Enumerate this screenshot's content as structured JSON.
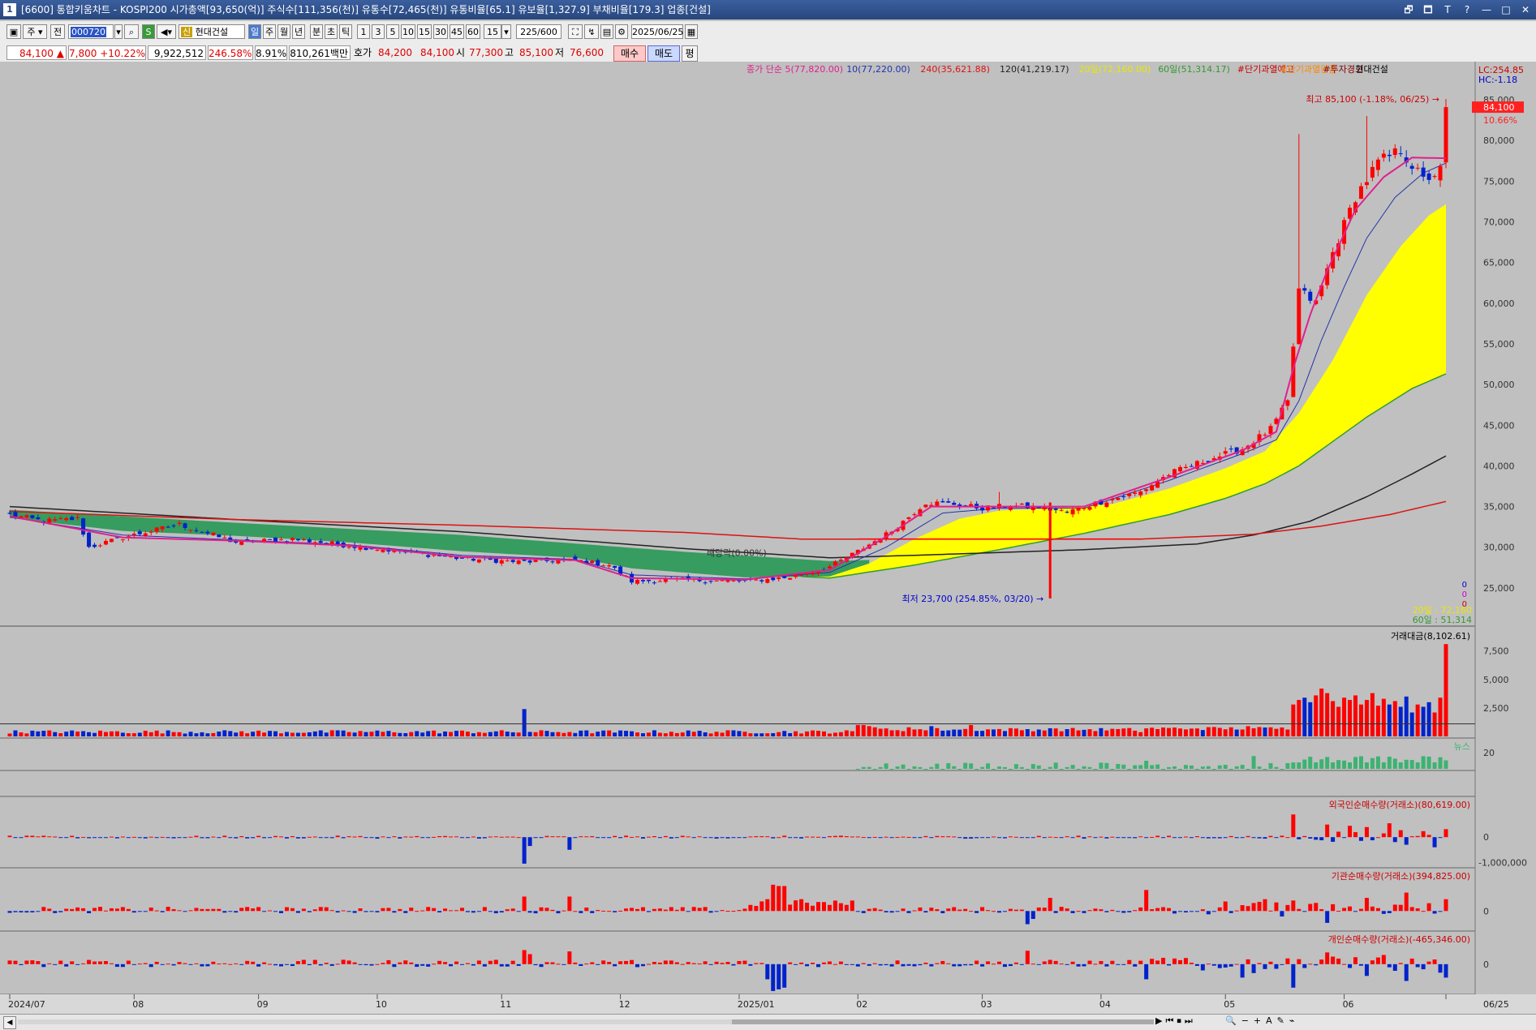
{
  "window": {
    "title": "[6600] 통합키움차트 - KOSPI200 시가총액[93,650(억)] 주식수[111,356(천)] 유통수[72,465(천)] 유통비율[65.1] 유보율[1,327.9] 부채비율[179.3] 업종[건설]",
    "controls": [
      "🗗",
      "🗖",
      "T",
      "?",
      "—",
      "□",
      "✕"
    ]
  },
  "toolbar": {
    "period": "주",
    "prev_label": "전",
    "code": "000720",
    "stock_name": "현대건설",
    "credit_badge": "신",
    "tf_active": "일",
    "tf_items": [
      "주",
      "월",
      "년",
      "분",
      "초",
      "틱"
    ],
    "intervals": [
      "1",
      "3",
      "5",
      "10",
      "15",
      "30",
      "45",
      "60",
      "15"
    ],
    "count": "225",
    "count_max": "/600",
    "date": "2025/06/25"
  },
  "quote": {
    "price": "84,100",
    "up_arrow": "▲",
    "change": "7,800",
    "change_pct": "+10.22%",
    "volume": "9,922,512",
    "volume_ratio": "246.58%",
    "turnover": "8.91%",
    "amount": "810,261백만",
    "hoga_label": "호가",
    "hoga1": "84,200",
    "hoga2": "84,100",
    "open_label": "시",
    "open": "77,300",
    "high_label": "고",
    "high": "85,100",
    "low_label": "저",
    "low": "76,600",
    "buy": "매수",
    "sell": "매도",
    "avg": "평"
  },
  "colors": {
    "up": "#ff0000",
    "down": "#0022cc",
    "ma5": "#e0208f",
    "ma10": "#2233aa",
    "ma240": "#dd1111",
    "ma120": "#222222",
    "ma20_fill": "#ffff00",
    "ma60": "#339933",
    "cloud": "#2e9a5a",
    "news": "#3cb371",
    "background": "#c0c0c0"
  },
  "chart_data": [
    {
      "type": "candlestick",
      "legend": [
        {
          "text": "종가 단순 5(77,820.00)",
          "color": "#e0208f"
        },
        {
          "text": "10(77,220.00)",
          "color": "#2233aa"
        },
        {
          "text": "240(35,621.88)",
          "color": "#dd1111"
        },
        {
          "text": "120(41,219.17)",
          "color": "#222222"
        },
        {
          "text": "20일(72,160.00)",
          "color": "#e8e800"
        },
        {
          "text": "60일(51,314.17)",
          "color": "#339933"
        },
        {
          "text": "#단기과열예고",
          "color": "#cc0000"
        },
        {
          "text": "#단기과열완출",
          "color": "#ff8800"
        },
        {
          "text": "#투자경고",
          "color": "#880000"
        },
        {
          "text": "현대건설",
          "color": "#000000"
        }
      ],
      "lc_label": "LC:254.85",
      "hc_label": "HC:-1.18",
      "price_label": "84,100",
      "pct_label": "10.66%",
      "high_annotation": "최고 85,100 (-1.18%, 06/25)",
      "low_annotation": "최저 23,700 (254.85%, 03/20)",
      "dividend_annotation": "배당락(0.00%)",
      "right_zero_labels": [
        "0",
        "0",
        "0"
      ],
      "ma20_label": "20일 : 72,160",
      "ma60_label": "60일 : 51,314",
      "y_ticks": [
        85000,
        80000,
        75000,
        70000,
        65000,
        60000,
        55000,
        50000,
        45000,
        40000,
        35000,
        30000,
        25000
      ],
      "y_tick_labels": [
        "85,000",
        "80,000",
        "75,000",
        "70,000",
        "65,000",
        "60,000",
        "55,000",
        "50,000",
        "45,000",
        "40,000",
        "35,000",
        "30,000",
        "25,000"
      ],
      "ylim": [
        20500,
        87500
      ],
      "x_labels": [
        {
          "text": "2024/07",
          "idx": 0
        },
        {
          "text": "08",
          "idx": 22
        },
        {
          "text": "09",
          "idx": 44
        },
        {
          "text": "10",
          "idx": 65
        },
        {
          "text": "11",
          "idx": 87
        },
        {
          "text": "12",
          "idx": 108
        },
        {
          "text": "2025/01",
          "idx": 129
        },
        {
          "text": "02",
          "idx": 150
        },
        {
          "text": "03",
          "idx": 172
        },
        {
          "text": "04",
          "idx": 193
        },
        {
          "text": "05",
          "idx": 215
        },
        {
          "text": "06",
          "idx": 236
        },
        {
          "text": "06/25",
          "idx": 254
        }
      ],
      "n_bars": 255,
      "close_anchors": [
        [
          0,
          34000
        ],
        [
          6,
          33200
        ],
        [
          12,
          33500
        ],
        [
          14,
          30000
        ],
        [
          20,
          31200
        ],
        [
          30,
          32800
        ],
        [
          40,
          30600
        ],
        [
          50,
          31000
        ],
        [
          60,
          30200
        ],
        [
          70,
          29400
        ],
        [
          80,
          28600
        ],
        [
          90,
          28200
        ],
        [
          100,
          28400
        ],
        [
          106,
          27800
        ],
        [
          110,
          25800
        ],
        [
          118,
          26000
        ],
        [
          130,
          25800
        ],
        [
          138,
          26300
        ],
        [
          145,
          27600
        ],
        [
          150,
          29500
        ],
        [
          156,
          32000
        ],
        [
          162,
          35500
        ],
        [
          167,
          35300
        ],
        [
          172,
          34800
        ],
        [
          177,
          35100
        ],
        [
          182,
          34900
        ],
        [
          187,
          34300
        ],
        [
          192,
          35400
        ],
        [
          200,
          36800
        ],
        [
          205,
          39000
        ],
        [
          212,
          40800
        ],
        [
          218,
          42100
        ],
        [
          223,
          44500
        ],
        [
          226,
          47800
        ],
        [
          228,
          61600
        ],
        [
          231,
          60000
        ],
        [
          234,
          66200
        ],
        [
          238,
          73100
        ],
        [
          242,
          77300
        ],
        [
          246,
          78800
        ],
        [
          250,
          75100
        ],
        [
          253,
          76300
        ],
        [
          254,
          84100
        ]
      ],
      "ma5_anchors": [
        [
          0,
          33800
        ],
        [
          20,
          31200
        ],
        [
          40,
          30800
        ],
        [
          60,
          30200
        ],
        [
          80,
          28800
        ],
        [
          100,
          28400
        ],
        [
          110,
          26200
        ],
        [
          130,
          26000
        ],
        [
          145,
          27200
        ],
        [
          155,
          31300
        ],
        [
          163,
          35000
        ],
        [
          175,
          35000
        ],
        [
          190,
          35000
        ],
        [
          205,
          38600
        ],
        [
          218,
          41900
        ],
        [
          224,
          44200
        ],
        [
          227,
          52000
        ],
        [
          230,
          58600
        ],
        [
          233,
          64000
        ],
        [
          238,
          71500
        ],
        [
          243,
          75500
        ],
        [
          248,
          77900
        ],
        [
          254,
          77820
        ]
      ],
      "ma10_anchors": [
        [
          0,
          33700
        ],
        [
          20,
          31500
        ],
        [
          40,
          30900
        ],
        [
          60,
          30300
        ],
        [
          80,
          29000
        ],
        [
          100,
          28500
        ],
        [
          110,
          26600
        ],
        [
          130,
          26100
        ],
        [
          145,
          26900
        ],
        [
          155,
          30000
        ],
        [
          165,
          34200
        ],
        [
          175,
          34800
        ],
        [
          190,
          34800
        ],
        [
          205,
          38200
        ],
        [
          218,
          41500
        ],
        [
          224,
          43200
        ],
        [
          228,
          48000
        ],
        [
          232,
          55500
        ],
        [
          236,
          62000
        ],
        [
          240,
          68000
        ],
        [
          245,
          73000
        ],
        [
          250,
          76000
        ],
        [
          254,
          77220
        ]
      ],
      "ma20_anchors": [
        [
          0,
          33600
        ],
        [
          20,
          32000
        ],
        [
          40,
          31400
        ],
        [
          60,
          30600
        ],
        [
          80,
          29500
        ],
        [
          100,
          28700
        ],
        [
          110,
          27400
        ],
        [
          130,
          26300
        ],
        [
          145,
          26400
        ],
        [
          152,
          28000
        ],
        [
          160,
          31000
        ],
        [
          168,
          33500
        ],
        [
          175,
          34500
        ],
        [
          185,
          34800
        ],
        [
          195,
          35300
        ],
        [
          205,
          37200
        ],
        [
          215,
          39700
        ],
        [
          222,
          41800
        ],
        [
          228,
          46500
        ],
        [
          234,
          53000
        ],
        [
          240,
          61000
        ],
        [
          246,
          67000
        ],
        [
          251,
          70800
        ],
        [
          254,
          72160
        ]
      ],
      "ma60_anchors": [
        [
          0,
          33800
        ],
        [
          30,
          32800
        ],
        [
          60,
          31600
        ],
        [
          90,
          29800
        ],
        [
          110,
          28200
        ],
        [
          130,
          26800
        ],
        [
          145,
          26200
        ],
        [
          160,
          27800
        ],
        [
          175,
          29700
        ],
        [
          190,
          31700
        ],
        [
          205,
          34000
        ],
        [
          215,
          36000
        ],
        [
          222,
          37800
        ],
        [
          228,
          40000
        ],
        [
          234,
          43000
        ],
        [
          240,
          46000
        ],
        [
          248,
          49500
        ],
        [
          254,
          51314
        ]
      ],
      "ma120_anchors": [
        [
          0,
          35000
        ],
        [
          40,
          33400
        ],
        [
          80,
          31900
        ],
        [
          120,
          29800
        ],
        [
          145,
          28700
        ],
        [
          160,
          29000
        ],
        [
          190,
          29700
        ],
        [
          210,
          30400
        ],
        [
          220,
          31500
        ],
        [
          230,
          33200
        ],
        [
          240,
          36200
        ],
        [
          248,
          39000
        ],
        [
          254,
          41219
        ]
      ],
      "ma240_anchors": [
        [
          0,
          34400
        ],
        [
          40,
          33400
        ],
        [
          80,
          32700
        ],
        [
          120,
          31800
        ],
        [
          140,
          31000
        ],
        [
          160,
          31000
        ],
        [
          200,
          31000
        ],
        [
          220,
          31600
        ],
        [
          232,
          32600
        ],
        [
          244,
          34000
        ],
        [
          254,
          35622
        ]
      ],
      "cloud_range": [
        0,
        152
      ]
    },
    {
      "type": "bar",
      "title": "거래대금(8,102.61)",
      "y_ticks": [
        7500,
        5000,
        2500
      ],
      "y_tick_labels": [
        "7,500",
        "5,000",
        "2,500"
      ],
      "ylim": [
        0,
        8400
      ],
      "spikes": [
        [
          91,
          2400
        ],
        [
          150,
          1000
        ],
        [
          151,
          1000
        ],
        [
          152,
          900
        ],
        [
          153,
          800
        ],
        [
          155,
          700
        ],
        [
          159,
          800
        ],
        [
          163,
          900
        ],
        [
          170,
          1000
        ],
        [
          185,
          700
        ],
        [
          210,
          700
        ],
        [
          219,
          900
        ],
        [
          227,
          2800
        ],
        [
          228,
          3200
        ],
        [
          229,
          3400
        ],
        [
          230,
          3000
        ],
        [
          231,
          3600
        ],
        [
          232,
          4200
        ],
        [
          233,
          3800
        ],
        [
          234,
          3100
        ],
        [
          235,
          2600
        ],
        [
          236,
          3400
        ],
        [
          237,
          3200
        ],
        [
          238,
          3600
        ],
        [
          239,
          2800
        ],
        [
          240,
          3200
        ],
        [
          241,
          3800
        ],
        [
          242,
          2700
        ],
        [
          243,
          3300
        ],
        [
          244,
          2800
        ],
        [
          245,
          3100
        ],
        [
          246,
          2600
        ],
        [
          247,
          3500
        ],
        [
          248,
          2100
        ],
        [
          249,
          2800
        ],
        [
          250,
          2600
        ],
        [
          251,
          3000
        ],
        [
          252,
          2100
        ],
        [
          253,
          3400
        ],
        [
          254,
          8102.61
        ]
      ],
      "baseline_level": 1100
    },
    {
      "type": "bar",
      "title": "뉴스",
      "y_tick_labels": [
        "20"
      ],
      "ylim": [
        0,
        22
      ],
      "start_idx": 150
    },
    {
      "type": "bar",
      "title": "외국인순매수량(거래소)(80,619.00)",
      "y_tick_labels": [
        "0",
        "-1,000,000"
      ],
      "ylim": [
        -1150000,
        1100000
      ],
      "spikes": [
        [
          91,
          -1050000
        ],
        [
          92,
          -350000
        ],
        [
          99,
          -500000
        ],
        [
          227,
          900000
        ],
        [
          233,
          500000
        ],
        [
          237,
          450000
        ],
        [
          240,
          400000
        ],
        [
          244,
          550000
        ],
        [
          247,
          -300000
        ],
        [
          252,
          -400000
        ]
      ]
    },
    {
      "type": "bar",
      "title": "기관순매수량(거래소)(394,825.00)",
      "y_tick_labels": [
        "0"
      ],
      "ylim": [
        -700000,
        1150000
      ],
      "spikes": [
        [
          91,
          550000
        ],
        [
          99,
          550000
        ],
        [
          134,
          450000
        ],
        [
          135,
          1000000
        ],
        [
          136,
          950000
        ],
        [
          137,
          950000
        ],
        [
          140,
          450000
        ],
        [
          180,
          -500000
        ],
        [
          181,
          -300000
        ],
        [
          184,
          500000
        ],
        [
          201,
          800000
        ],
        [
          221,
          350000
        ],
        [
          222,
          450000
        ],
        [
          227,
          400000
        ],
        [
          233,
          -450000
        ],
        [
          240,
          500000
        ],
        [
          247,
          700000
        ],
        [
          254,
          450000
        ]
      ]
    },
    {
      "type": "bar",
      "title": "개인순매수량(거래소)(-465,346.00)",
      "y_tick_labels": [
        "0"
      ],
      "ylim": [
        -850000,
        600000
      ],
      "spikes": [
        [
          91,
          420000
        ],
        [
          92,
          300000
        ],
        [
          99,
          380000
        ],
        [
          134,
          -450000
        ],
        [
          135,
          -800000
        ],
        [
          136,
          -750000
        ],
        [
          137,
          -700000
        ],
        [
          180,
          400000
        ],
        [
          201,
          -450000
        ],
        [
          218,
          -400000
        ],
        [
          227,
          -700000
        ],
        [
          233,
          350000
        ],
        [
          240,
          -350000
        ],
        [
          247,
          -500000
        ],
        [
          254,
          -400000
        ]
      ]
    }
  ],
  "statusbar": {
    "nav_icons": [
      "▶",
      "⏮",
      "⏹",
      "⏭"
    ],
    "zoom_icons": [
      "🔍",
      "−",
      "+",
      "A",
      "✎",
      "⌁"
    ]
  }
}
